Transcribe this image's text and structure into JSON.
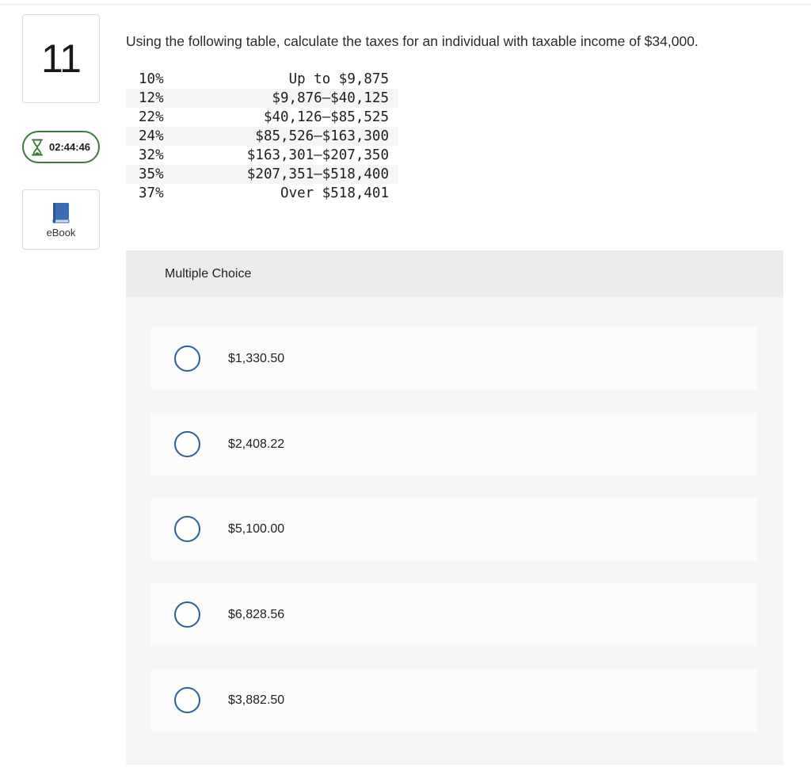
{
  "question": {
    "number": "11",
    "text": "Using the following table, calculate the taxes for an individual with taxable income of $34,000."
  },
  "timer": {
    "value": "02:44:46",
    "icon": "hourglass-icon",
    "color": "#3d7a3a"
  },
  "ebook": {
    "label": "eBook",
    "icon": "book-icon",
    "color": "#3b6db3"
  },
  "tax_table": {
    "rows": [
      {
        "rate": "10%",
        "range": "Up to $9,875"
      },
      {
        "rate": "12%",
        "range": "$9,876–$40,125"
      },
      {
        "rate": "22%",
        "range": "$40,126–$85,525"
      },
      {
        "rate": "24%",
        "range": "$85,526–$163,300"
      },
      {
        "rate": "32%",
        "range": "$163,301–$207,350"
      },
      {
        "rate": "35%",
        "range": "$207,351–$518,400"
      },
      {
        "rate": "37%",
        "range": "Over $518,401"
      }
    ]
  },
  "multiple_choice": {
    "header": "Multiple Choice",
    "radio_color": "#2c5f99",
    "options": [
      {
        "label": "$1,330.50"
      },
      {
        "label": "$2,408.22"
      },
      {
        "label": "$5,100.00"
      },
      {
        "label": "$6,828.56"
      },
      {
        "label": "$3,882.50"
      }
    ]
  }
}
